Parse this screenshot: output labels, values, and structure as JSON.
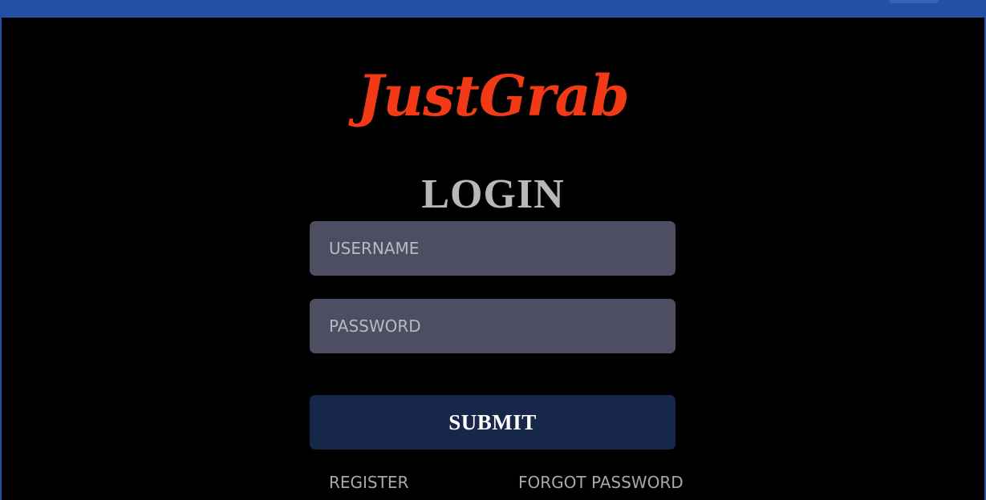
{
  "header": {
    "accent_color": "#2350a4"
  },
  "brand": {
    "logo_text": "JustGrab",
    "logo_color": "#f23a17"
  },
  "form": {
    "title": "LOGIN",
    "username_placeholder": "USERNAME",
    "password_placeholder": "PASSWORD",
    "username_value": "",
    "password_value": "",
    "submit_label": "SUBMIT"
  },
  "links": {
    "register": "REGISTER",
    "forgot_password": "FORGOT PASSWORD"
  }
}
